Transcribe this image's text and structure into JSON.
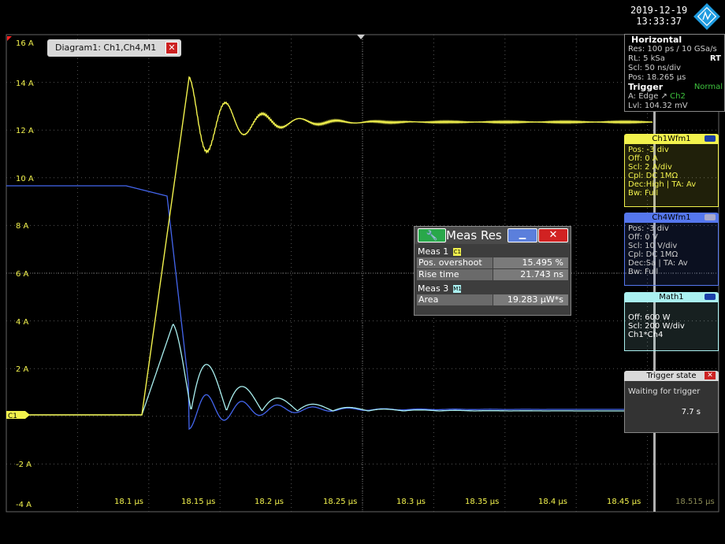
{
  "header": {
    "date": "2019-12-19",
    "time": "13:33:37"
  },
  "diagram": {
    "tab_label": "Diagram1: Ch1,Ch4,M1",
    "close_label": "✕",
    "y_ticks": [
      "16 A",
      "14 A",
      "12 A",
      "10 A",
      "8 A",
      "6 A",
      "4 A",
      "2 A",
      "C1",
      "-2 A",
      "-4 A"
    ],
    "x_ticks": [
      "18.1 µs",
      "18.15 µs",
      "18.2 µs",
      "18.25 µs",
      "18.3 µs",
      "18.35 µs",
      "18.4 µs",
      "18.45 µs",
      "18.515 µs"
    ]
  },
  "horizontal": {
    "title": "Horizontal",
    "res": "Res: 100 ps / 10 GSa/s",
    "rl": "RL: 5 kSa",
    "rt": "RT",
    "scl": "Scl: 50 ns/div",
    "pos": "Pos: 18.265 µs"
  },
  "trigger": {
    "title": "Trigger",
    "mode": "Normal",
    "source_prefix": "A: Edge ↗",
    "source": "Ch2",
    "lvl": "Lvl: 104.32 mV"
  },
  "ch1": {
    "title": "Ch1Wfm1",
    "lines": [
      "Pos: -3 div",
      "Off: 0 A",
      "Scl: 2 A/div",
      "Cpl: DC 1MΩ",
      "Dec:High | TA: Av",
      "Bw: Full"
    ]
  },
  "ch4": {
    "title": "Ch4Wfm1",
    "lines": [
      "Pos: -3 div",
      "Off: 0 V",
      "Scl: 10 V/div",
      "Cpl: DC 1MΩ",
      "Dec:Sa | TA: Av",
      "Bw: Full"
    ]
  },
  "math": {
    "title": "Math1",
    "lines": [
      "Off: 600 W",
      "Scl: 200 W/div",
      "Ch1*Ch4"
    ]
  },
  "trigger_state": {
    "title": "Trigger state",
    "close_label": "✕",
    "status": "Waiting for trigger",
    "time": "7.7 s"
  },
  "meas": {
    "title": "Meas Res",
    "wrench": "🔧",
    "min": "▁",
    "close": "✕",
    "m1_label": "Meas 1",
    "m1_badge": "C1",
    "rows1": [
      {
        "k": "Pos. overshoot",
        "v": "15.495 %"
      },
      {
        "k": "Rise time",
        "v": "21.743 ns"
      }
    ],
    "m3_label": "Meas 3",
    "m3_badge": "M1",
    "rows3": [
      {
        "k": "Area",
        "v": "19.283 µW*s"
      }
    ]
  },
  "colors": {
    "ch1": "#f2f24d",
    "ch4": "#5577ee",
    "math": "#aaf0f0",
    "accent_red": "#d12222",
    "accent_green": "#29a84a"
  }
}
